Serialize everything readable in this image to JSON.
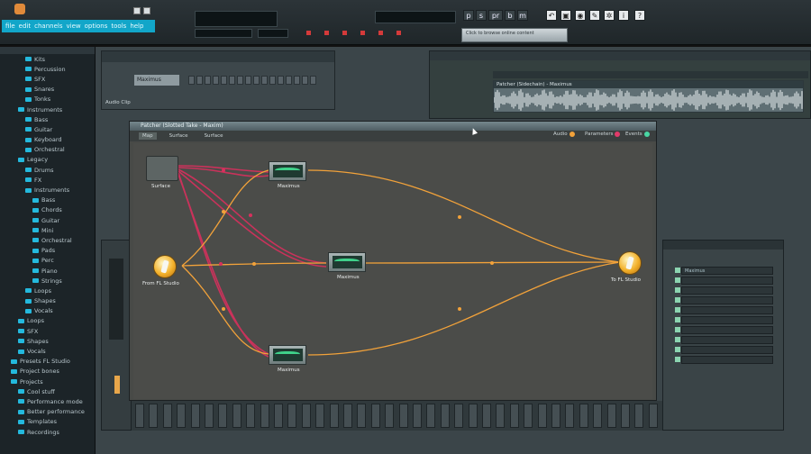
{
  "menu": [
    "file",
    "edit",
    "channels",
    "view",
    "options",
    "tools",
    "help"
  ],
  "toolbar": {
    "pattern_letters": [
      "p",
      "s",
      "pr",
      "b",
      "m"
    ],
    "hint": "Click to browse online content"
  },
  "browser": {
    "items": [
      {
        "label": "Kits",
        "level": 2
      },
      {
        "label": "Percussion",
        "level": 2
      },
      {
        "label": "SFX",
        "level": 2
      },
      {
        "label": "Snares",
        "level": 2
      },
      {
        "label": "Tonks",
        "level": 2
      },
      {
        "label": "Instruments",
        "level": 1
      },
      {
        "label": "Bass",
        "level": 2
      },
      {
        "label": "Guitar",
        "level": 2
      },
      {
        "label": "Keyboard",
        "level": 2
      },
      {
        "label": "Orchestral",
        "level": 2
      },
      {
        "label": "Legacy",
        "level": 1
      },
      {
        "label": "Drums",
        "level": 2
      },
      {
        "label": "FX",
        "level": 2
      },
      {
        "label": "Instruments",
        "level": 2
      },
      {
        "label": "Bass",
        "level": 3
      },
      {
        "label": "Chords",
        "level": 3
      },
      {
        "label": "Guitar",
        "level": 3
      },
      {
        "label": "Mini",
        "level": 3
      },
      {
        "label": "Orchestral",
        "level": 3
      },
      {
        "label": "Pads",
        "level": 3
      },
      {
        "label": "Perc",
        "level": 3
      },
      {
        "label": "Piano",
        "level": 3
      },
      {
        "label": "Strings",
        "level": 3
      },
      {
        "label": "Loops",
        "level": 2
      },
      {
        "label": "Shapes",
        "level": 2
      },
      {
        "label": "Vocals",
        "level": 2
      },
      {
        "label": "Loops",
        "level": 1
      },
      {
        "label": "SFX",
        "level": 1
      },
      {
        "label": "Shapes",
        "level": 1
      },
      {
        "label": "Vocals",
        "level": 1
      },
      {
        "label": "Presets FL Studio",
        "level": 0
      },
      {
        "label": "Project bones",
        "level": 0
      },
      {
        "label": "Projects",
        "level": 0
      },
      {
        "label": "Cool stuff",
        "level": 1
      },
      {
        "label": "Performance mode",
        "level": 1
      },
      {
        "label": "Better performance",
        "level": 1
      },
      {
        "label": "Templates",
        "level": 1
      },
      {
        "label": "Recordings",
        "level": 1
      }
    ]
  },
  "channel_rack": {
    "channel_name": "Maximus",
    "footer": "Audio Clip"
  },
  "playlist": {
    "clip_title": "Patcher (Sidechain) - Maximus"
  },
  "patcher": {
    "title": "Patcher (Slotted Take - Maxim)",
    "tabs": [
      "Map",
      "Surface",
      "Surface"
    ],
    "legend": [
      {
        "label": "Audio",
        "color": "#f2a23a"
      },
      {
        "label": "Parameters",
        "color": "#e23a6a"
      },
      {
        "label": "Events",
        "color": "#49d6a3"
      }
    ],
    "nodes": {
      "surface": "Surface",
      "from": "From FL Studio",
      "to": "To FL Studio",
      "maximus_top": "Maximus",
      "maximus_mid": "Maximus",
      "maximus_bot": "Maximus"
    }
  },
  "mixer": {
    "slots": [
      "Maximus",
      "",
      "",
      "",
      "",
      "",
      "",
      "",
      "",
      ""
    ]
  },
  "colors": {
    "audio_wire": "#f2a23a",
    "param_wire": "#d8305d",
    "accent": "#12a6c9"
  }
}
